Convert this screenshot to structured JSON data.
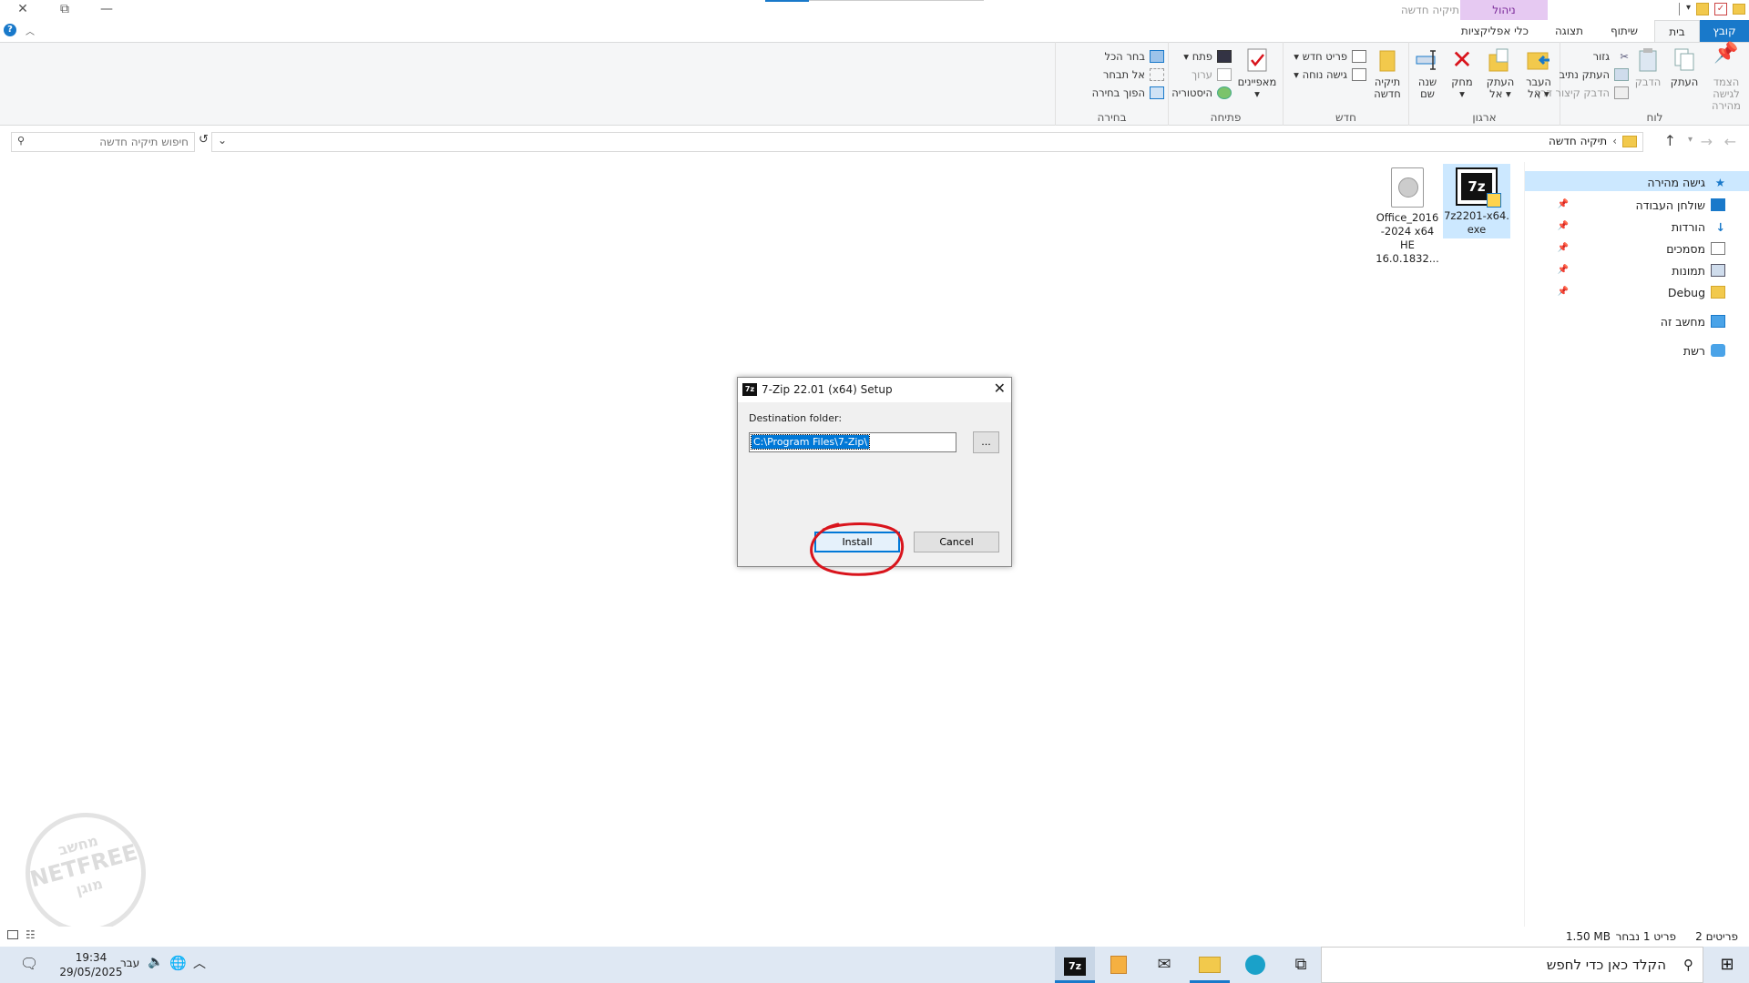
{
  "titlebar": {
    "title": "תיקיה חדשה",
    "context_group": "ניהול",
    "close": "✕",
    "restore": "⧉",
    "minimize": "—"
  },
  "tabs": {
    "file": "קובץ",
    "home": "בית",
    "share": "שיתוף",
    "view": "תצוגה",
    "app_tools": "כלי אפליקציות"
  },
  "ribbon": {
    "clipboard": {
      "label": "לוח",
      "pin": "הצמד לגישה מהירה",
      "copy": "העתק",
      "paste": "הדבק",
      "cut": "גזור",
      "copy_path": "העתק נתיב",
      "paste_shortcut": "הדבק קיצור דרך"
    },
    "organize": {
      "label": "ארגון",
      "move_to": "העבר אל",
      "copy_to": "העתק אל",
      "delete": "מחק",
      "rename": "שנה שם"
    },
    "new": {
      "label": "חדש",
      "new_folder": "תיקיה חדשה",
      "new_item": "פריט חדש",
      "easy_access": "גישה נוחה"
    },
    "open": {
      "label": "פתיחה",
      "properties": "מאפיינים",
      "open": "פתח",
      "edit": "ערוך",
      "history": "היסטוריה"
    },
    "select": {
      "label": "בחירה",
      "select_all": "בחר הכל",
      "select_none": "אל תבחר",
      "invert": "הפוך בחירה"
    }
  },
  "address": {
    "path": "תיקיה חדשה",
    "search_placeholder": "חיפוש תיקיה חדשה"
  },
  "nav": {
    "quick_access": "גישה מהירה",
    "desktop": "שולחן העבודה",
    "downloads": "הורדות",
    "documents": "מסמכים",
    "pictures": "תמונות",
    "debug": "Debug",
    "this_pc": "מחשב זה",
    "network": "רשת"
  },
  "files": [
    {
      "name": "7z2201-x64.\nexe"
    },
    {
      "name": "Office_2016\n-2024 x64\nHE\n16.0.1832..."
    }
  ],
  "dialog": {
    "title": "7-Zip 22.01 (x64) Setup",
    "dest_label": "Destination folder:",
    "path": "C:\\Program Files\\7-Zip\\",
    "browse": "...",
    "install": "Install",
    "cancel": "Cancel",
    "icon_text": "7z"
  },
  "status": {
    "items": "2 פריטים",
    "selected": "פריט 1 נבחר",
    "size": "1.50 MB"
  },
  "watermark": {
    "top": "מחשב",
    "brand": "NETFREE",
    "bottom": "מוגן"
  },
  "taskbar": {
    "search": "הקלד כאן כדי לחפש",
    "time": "19:34",
    "date": "29/05/2025",
    "lang": "עבר",
    "sevenzip": "7z"
  },
  "colors": {
    "accent": "#1979ca",
    "context": "#e6c9f2",
    "selection": "#cce8ff",
    "annotation": "#d9141c"
  }
}
